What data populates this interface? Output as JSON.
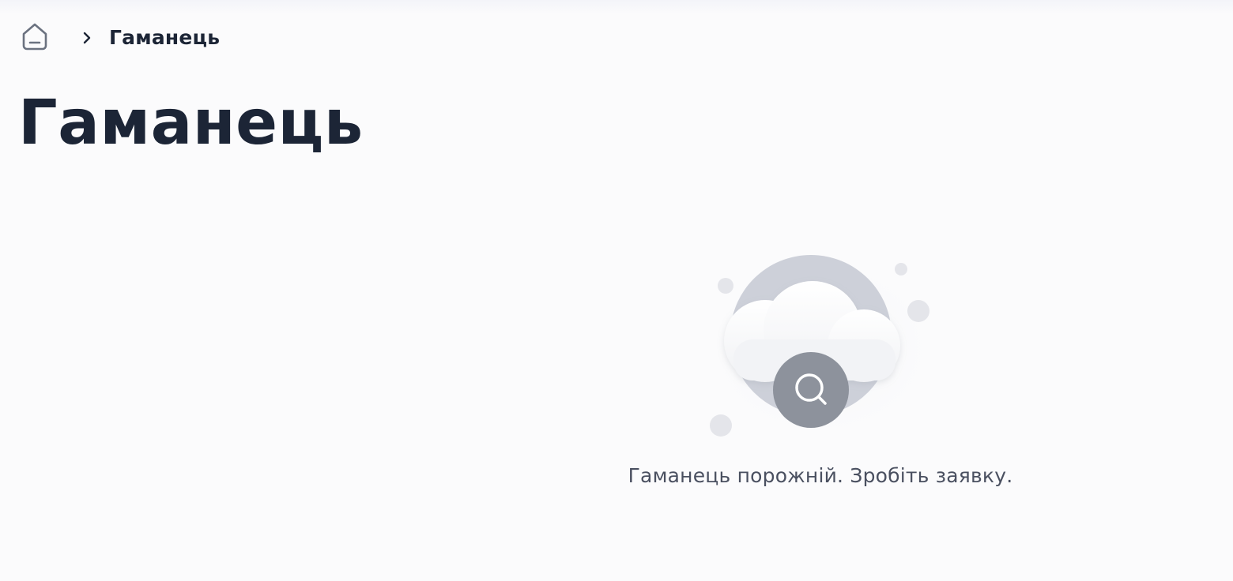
{
  "breadcrumb": {
    "home_icon": "home-icon",
    "separator_icon": "chevron-right-icon",
    "current": "Гаманець"
  },
  "page": {
    "title": "Гаманець"
  },
  "empty_state": {
    "illustration": "cloud-search-illustration",
    "search_icon": "search-icon",
    "message": "Гаманець порожній. Зробіть заявку."
  },
  "colors": {
    "background": "#fbfbfc",
    "text_primary": "#1c2536",
    "text_secondary": "#4a5060",
    "illustration_circle": "#cdd0d9",
    "search_badge": "#8d929c"
  }
}
